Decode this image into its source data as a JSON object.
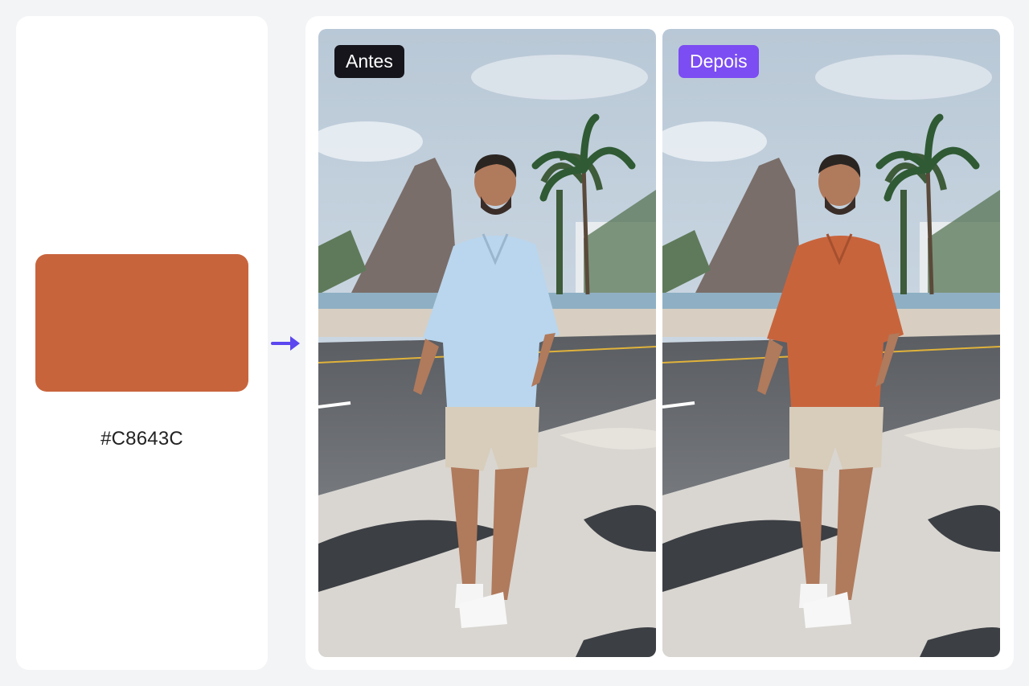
{
  "swatch": {
    "hex": "#C8643C",
    "color": "#C8643C"
  },
  "comparison": {
    "before": {
      "label": "Antes",
      "badge_color": "#15151b",
      "shirt_color": "#b9d6ee"
    },
    "after": {
      "label": "Depois",
      "badge_color": "#7b4df2",
      "shirt_color": "#c8643c"
    }
  },
  "arrow": {
    "icon": "arrow-right-icon",
    "color": "#5b46f0"
  }
}
